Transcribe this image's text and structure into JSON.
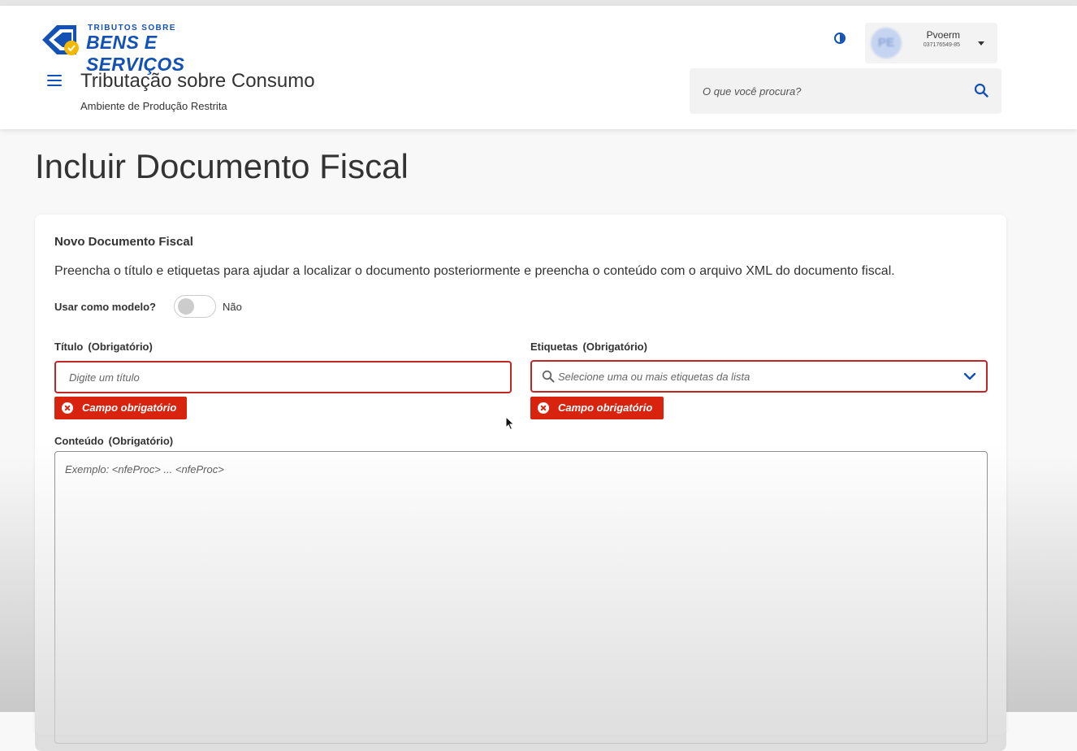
{
  "header": {
    "logo": {
      "small": "TRIBUTOS SOBRE",
      "big": "BENS E SERVIÇOS"
    },
    "app_title": "Tributação sobre Consumo",
    "environment": "Ambiente de Produção Restrita",
    "contrast_icon": "contrast-icon",
    "user": {
      "avatar_initials": "PE",
      "name": "Pvoerm",
      "cpf": "037176549-85"
    },
    "search": {
      "placeholder": "O que você procura?",
      "icon": "search-icon"
    }
  },
  "page": {
    "title": "Incluir Documento Fiscal"
  },
  "card": {
    "title": "Novo Documento Fiscal",
    "description": "Preencha o título e etiquetas para ajudar a localizar o documento posteriormente e preencha o conteúdo com o arquivo XML do documento fiscal.",
    "template_toggle": {
      "label": "Usar como modelo?",
      "value_text": "Não",
      "checked": false
    },
    "titulo": {
      "label": "Título",
      "required": "(Obrigatório)",
      "placeholder": "Digite um título",
      "value": "",
      "error": "Campo obrigatório"
    },
    "etiquetas": {
      "label": "Etiquetas",
      "required": "(Obrigatório)",
      "placeholder": "Selecione uma ou mais etiquetas da lista",
      "error": "Campo obrigatório"
    },
    "conteudo": {
      "label": "Conteúdo",
      "required": "(Obrigatório)",
      "placeholder": "Exemplo: <nfeProc> ... <nfeProc>",
      "value": ""
    }
  },
  "colors": {
    "primary": "#1351b4",
    "error": "#d8230f",
    "error_border": "#c32424",
    "text": "#333333",
    "background": "#f8f8f8"
  }
}
